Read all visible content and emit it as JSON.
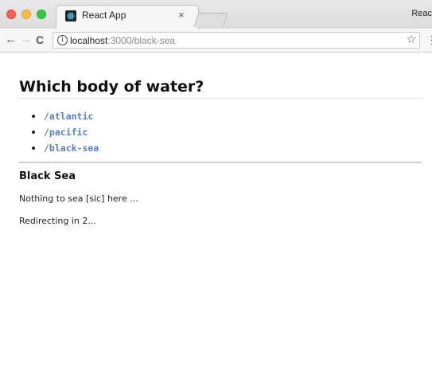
{
  "browser": {
    "tab_title": "React App",
    "tab_close": "×",
    "window_title": "Reac",
    "url_host": "localhost",
    "url_path": ":3000/black-sea",
    "info_icon": "ⓘ",
    "back_icon": "←",
    "forward_icon": "→",
    "reload_icon": "C",
    "star_icon": "☆",
    "menu_icon": "⋮"
  },
  "page": {
    "heading": "Which body of water?",
    "routes": [
      {
        "label": "/atlantic"
      },
      {
        "label": "/pacific"
      },
      {
        "label": "/black-sea"
      }
    ],
    "section_title": "Black Sea",
    "paragraph_1": "Nothing to sea [sic] here ...",
    "paragraph_2": "Redirecting in 2..."
  },
  "colors": {
    "link": "#5b7fbf",
    "traffic_red": "#fc605c",
    "traffic_yellow": "#fdbc40",
    "traffic_green": "#34c84a"
  }
}
